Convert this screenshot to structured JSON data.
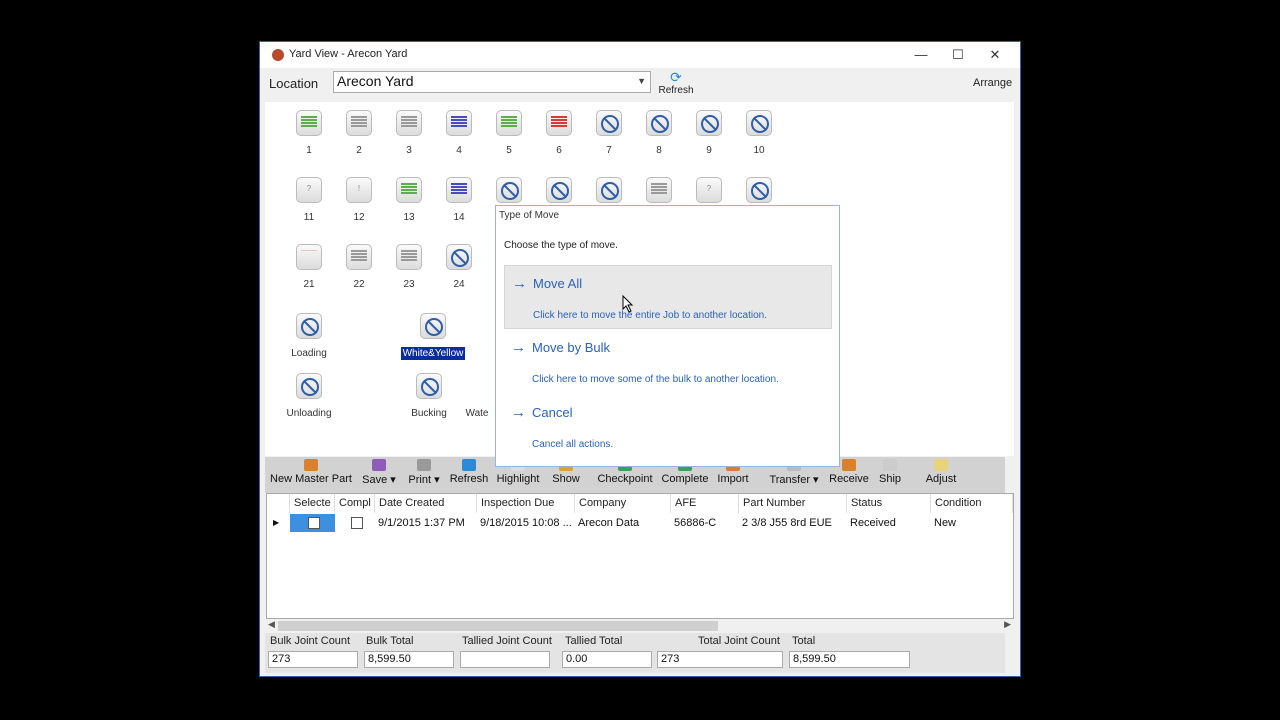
{
  "window": {
    "title": "Yard View - Arecon Yard",
    "minimize": "—",
    "maximize": "☐",
    "close": "✕"
  },
  "location": {
    "label": "Location",
    "value": "Arecon Yard"
  },
  "refresh_label": "Refresh",
  "arrange_label": "Arrange",
  "slots": {
    "s1": "1",
    "s2": "2",
    "s3": "3",
    "s4": "4",
    "s5": "5",
    "s6": "6",
    "s7": "7",
    "s8": "8",
    "s9": "9",
    "s10": "10",
    "s11": "11",
    "s12": "12",
    "s13": "13",
    "s14": "14",
    "s21": "21",
    "s22": "22",
    "s23": "23",
    "s24": "24",
    "loading": "Loading",
    "white_yellow": "White&Yellow",
    "water": "Wate",
    "unloading": "Unloading",
    "bucking": "Bucking"
  },
  "colors": {
    "green": "#5fae4c",
    "gray": "#9a9a9a",
    "blue": "#4b4bbd",
    "red": "#d83a3a",
    "accent": "#2a62b5"
  },
  "toolbar": {
    "new_master_part": "New Master Part",
    "save": "Save",
    "print": "Print",
    "refresh": "Refresh",
    "highlight": "Highlight",
    "show": "Show",
    "checkpoint": "Checkpoint",
    "complete": "Complete",
    "import": "Import",
    "transfer": "Transfer",
    "receive": "Receive",
    "ship": "Ship",
    "adjust": "Adjust"
  },
  "grid": {
    "columns": [
      "Selecte",
      "Compl",
      "Date Created",
      "Inspection Due",
      "Company",
      "AFE",
      "Part Number",
      "Status",
      "Condition"
    ],
    "row": {
      "date_created": "9/1/2015 1:37 PM",
      "inspection_due": "9/18/2015 10:08 ...",
      "company": "Arecon Data",
      "afe": "56886-C",
      "part_number": "2 3/8 J55 8rd EUE",
      "status": "Received",
      "condition": "New"
    }
  },
  "totals": {
    "bulk_joint_count_label": "Bulk Joint Count",
    "bulk_joint_count": "273",
    "bulk_total_label": "Bulk Total",
    "bulk_total": "8,599.50",
    "tallied_joint_count_label": "Tallied Joint Count",
    "tallied_joint_count": "",
    "tallied_total_label": "Tallied Total",
    "tallied_total": "0.00",
    "total_joint_count_label": "Total Joint Count",
    "total_joint_count": "273",
    "total_label": "Total",
    "total": "8,599.50"
  },
  "dialog": {
    "title": "Type of Move",
    "instruction": "Choose the type of move.",
    "move_all": "Move All",
    "move_all_desc": "Click here to move the entire Job to another location.",
    "move_bulk": "Move by Bulk",
    "move_bulk_desc": "Click here to move some of the bulk to another location.",
    "cancel": "Cancel",
    "cancel_desc": "Cancel all actions."
  }
}
